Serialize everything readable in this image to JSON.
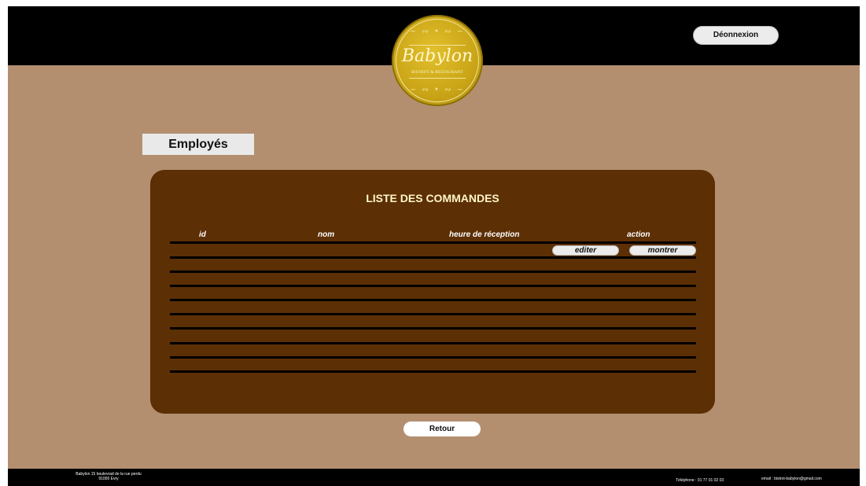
{
  "header": {
    "logo": {
      "name": "Babylon",
      "tagline": "BISTROT & RESTAURANT"
    },
    "logout_label": "Déonnexion"
  },
  "page": {
    "title": "Employés"
  },
  "orders": {
    "title": "LISTE DES COMMANDES",
    "columns": [
      "id",
      "nom",
      "heure de réception",
      "action"
    ],
    "actions": [
      "editer",
      "montrer"
    ]
  },
  "back_label": "Retour",
  "footer": {
    "address_line1": "Babylon 15 boulevrad de la rue perdu",
    "address_line2": "91000 Evry",
    "phone": "Téléphone : 01 77 01 02 03",
    "email": "email : bistrot-babylon@gmail.com"
  },
  "colors": {
    "background": "#b38f70",
    "header": "#000000",
    "panel": "#5c2f05",
    "panel_title": "#fff6c8",
    "logo_gold": "#c9a416"
  }
}
